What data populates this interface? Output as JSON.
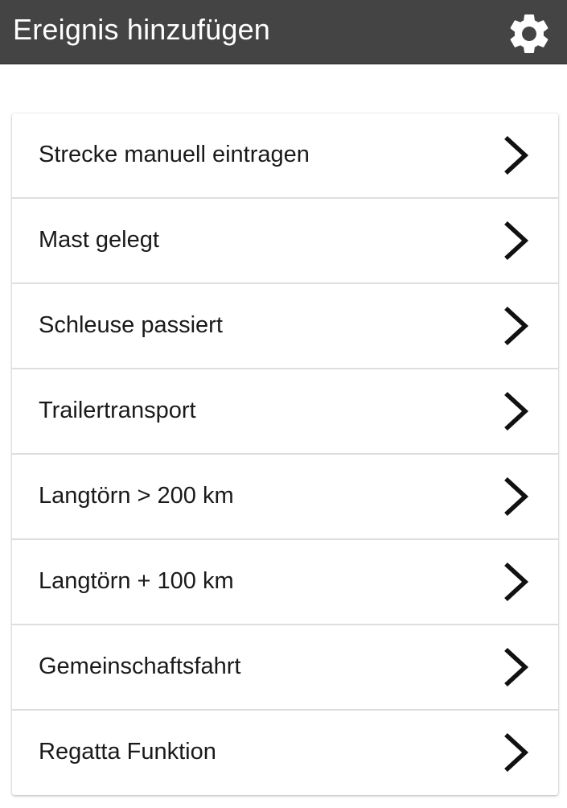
{
  "appbar": {
    "title": "Ereignis hinzufügen",
    "background": "#444444",
    "settings_icon": "gear-icon"
  },
  "menu": {
    "items": [
      {
        "label": "Strecke manuell eintragen",
        "icon": "chevron-right-icon"
      },
      {
        "label": "Mast gelegt",
        "icon": "chevron-right-icon"
      },
      {
        "label": "Schleuse passiert",
        "icon": "chevron-right-icon"
      },
      {
        "label": "Trailertransport",
        "icon": "chevron-right-icon"
      },
      {
        "label": "Langtörn > 200 km",
        "icon": "chevron-right-icon"
      },
      {
        "label": "Langtörn + 100 km",
        "icon": "chevron-right-icon"
      },
      {
        "label": "Gemeinschaftsfahrt",
        "icon": "chevron-right-icon"
      },
      {
        "label": "Regatta Funktion",
        "icon": "chevron-right-icon"
      }
    ]
  }
}
